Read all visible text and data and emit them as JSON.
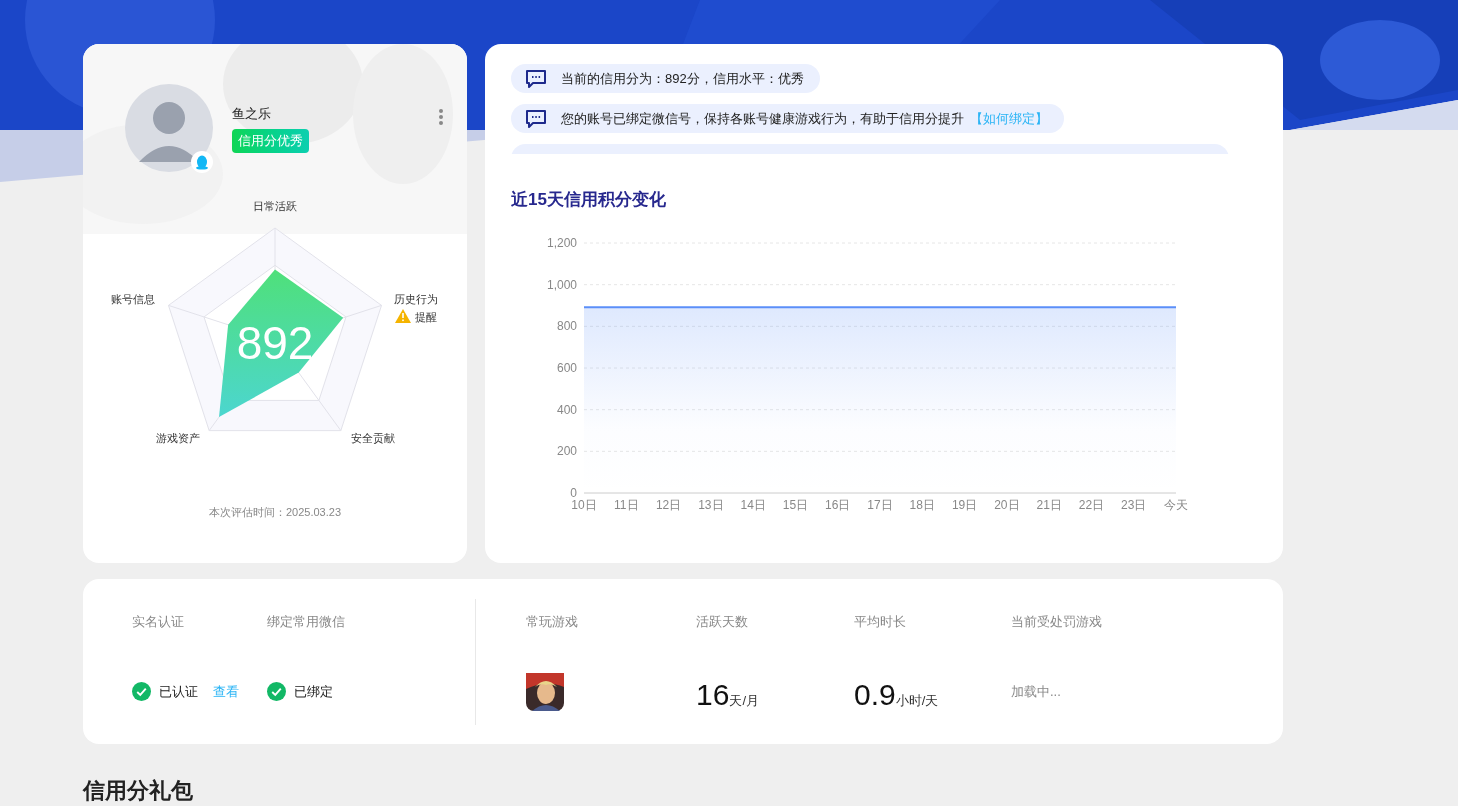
{
  "profile": {
    "name": "鱼之乐",
    "badge": "信用分优秀",
    "score": "892",
    "axes": [
      {
        "label": "日常活跃"
      },
      {
        "label": "历史行为",
        "alert": "提醒"
      },
      {
        "label": "安全贡献"
      },
      {
        "label": "游戏资产"
      },
      {
        "label": "账号信息"
      }
    ],
    "eval_time": "本次评估时间：2025.03.23"
  },
  "messages": [
    {
      "kind": "full",
      "text": "当前的信用分为：892分，信用水平：优秀"
    },
    {
      "kind": "full",
      "text": "您的账号已绑定微信号，保持各账号健康游戏行为，有助于信用分提升",
      "link": "【如何绑定】"
    },
    {
      "kind": "clipped"
    }
  ],
  "chart": {
    "title": "近15天信用积分变化",
    "chart_data": {
      "type": "area",
      "categories": [
        "10日",
        "11日",
        "12日",
        "13日",
        "14日",
        "15日",
        "16日",
        "17日",
        "18日",
        "19日",
        "20日",
        "21日",
        "22日",
        "23日",
        "今天"
      ],
      "grid": true,
      "series": [
        {
          "color": "#5b8ff9",
          "values": [
            892,
            892,
            892,
            892,
            892,
            892,
            892,
            892,
            892,
            892,
            892,
            892,
            892,
            892,
            892
          ]
        }
      ],
      "ylim": [
        0,
        1200
      ],
      "yticks": [
        0,
        200,
        400,
        600,
        800,
        {
          "value": 1000,
          "label": "1,000"
        },
        {
          "value": 1200,
          "label": "1,200"
        }
      ]
    }
  },
  "account": [
    {
      "label": "实名认证",
      "value": "已认证",
      "link": "查看",
      "checked": true
    },
    {
      "label": "绑定常用微信",
      "value": "已绑定",
      "checked": true
    }
  ],
  "stats": [
    {
      "kind": "game",
      "label": "常玩游戏"
    },
    {
      "kind": "number",
      "label": "活跃天数",
      "value": "16",
      "unit": "天/月"
    },
    {
      "kind": "number",
      "label": "平均时长",
      "value": "0.9",
      "unit": "小时/天"
    },
    {
      "kind": "text",
      "label": "当前受处罚游戏",
      "value": "加载中..."
    }
  ],
  "section_title": "信用分礼包"
}
